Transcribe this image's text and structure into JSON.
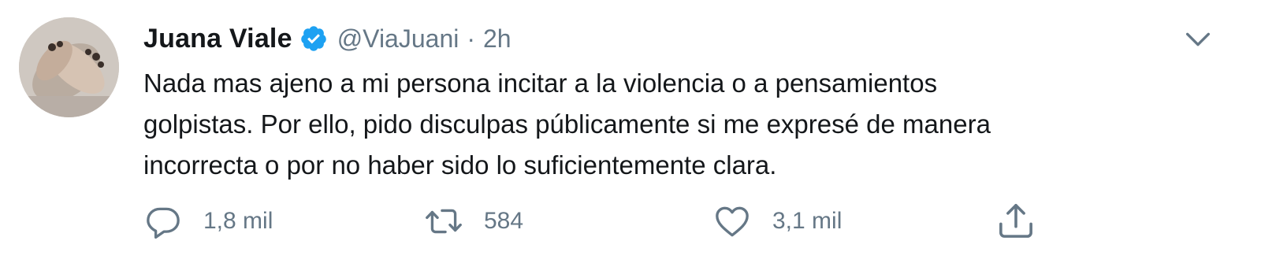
{
  "tweet": {
    "display_name": "Juana Viale",
    "handle": "@ViaJuani",
    "separator": "·",
    "time": "2h",
    "text_lines": [
      "Nada mas ajeno a mi persona incitar a la violencia o a pensamientos",
      "golpistas. Por ello, pido disculpas públicamente si me expresé de manera",
      "incorrecta o por no haber sido lo suficientemente clara."
    ],
    "verified": true,
    "avatar_icon": "avatar-photo"
  },
  "actions": {
    "reply": {
      "icon": "reply-icon",
      "count": "1,8 mil"
    },
    "retweet": {
      "icon": "retweet-icon",
      "count": "584"
    },
    "like": {
      "icon": "heart-icon",
      "count": "3,1 mil"
    },
    "share": {
      "icon": "share-icon"
    }
  },
  "colors": {
    "text": "#14171a",
    "muted": "#657786",
    "verified_blue": "#1da1f2",
    "background": "#ffffff"
  }
}
